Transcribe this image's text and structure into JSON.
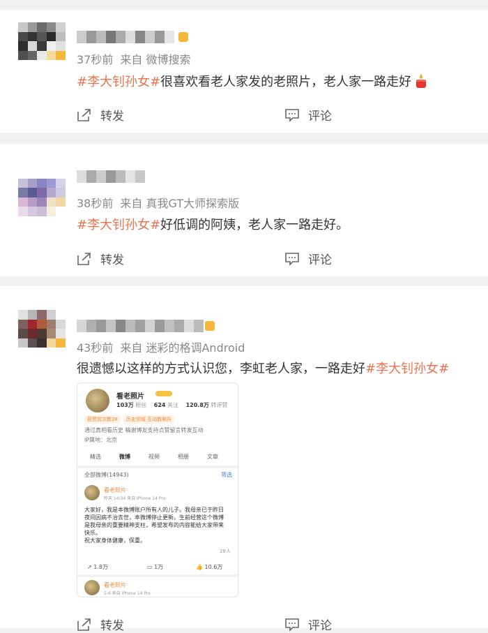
{
  "accent": "#eb7350",
  "posts": [
    {
      "time": "37秒前",
      "source_prefix": "来自",
      "source": "微博搜索",
      "hashtag": "#李大钊孙女#",
      "text": "很喜欢看老人家发的老照片，老人家一路走好",
      "repost": "转发",
      "comment": "评论"
    },
    {
      "time": "38秒前",
      "source_prefix": "来自",
      "source": "真我GT大师探索版",
      "hashtag": "#李大钊孙女#",
      "text": "好低调的阿姨，老人家一路走好。",
      "repost": "转发",
      "comment": "评论"
    },
    {
      "time": "43秒前",
      "source_prefix": "来自",
      "source": "迷彩的格调Android",
      "text": "很遗憾以这样的方式认识您，李虹老人家，一路走好",
      "hashtag": "#李大钊孙女#",
      "repost": "转发",
      "comment": "评论"
    }
  ],
  "embedded": {
    "name": "看老照片",
    "followers_num": "103万",
    "followers_label": "粉丝",
    "following_num": "624",
    "following_label": "关注",
    "likes_num": "120.8万",
    "likes_label": "转评赞",
    "pill1": "获赞赏次数38",
    "pill2": "历史领域 互动数飙升",
    "intro": "通过真相看历史 稿谢博友支持点赞留言转发互动",
    "ip": "IP属地：北京",
    "tabs": [
      "精选",
      "微博",
      "视频",
      "相册",
      "文章"
    ],
    "all_label": "全部微博(14943)",
    "filter": "筛选",
    "post_name": "看老照片",
    "post_time": "昨天 14:34  来自 iPhone 14 Pro",
    "post_lines": [
      "大家好，我是本微博账户所有人的儿子。我母亲已于昨日",
      "夜间因病不治去世，本微博停止更新。生前经营这个微博",
      "是我母亲的重要精神支柱，希望发布的内容能给大家带来",
      "快乐。",
      "祝大家身体健康，保重。"
    ],
    "likes_small": "28人",
    "share": "1.8万",
    "comments": "1万",
    "likes": "10.6万",
    "post2_name": "看老照片",
    "post2_time": "5-6  来自 iPhone 14 Pro"
  }
}
